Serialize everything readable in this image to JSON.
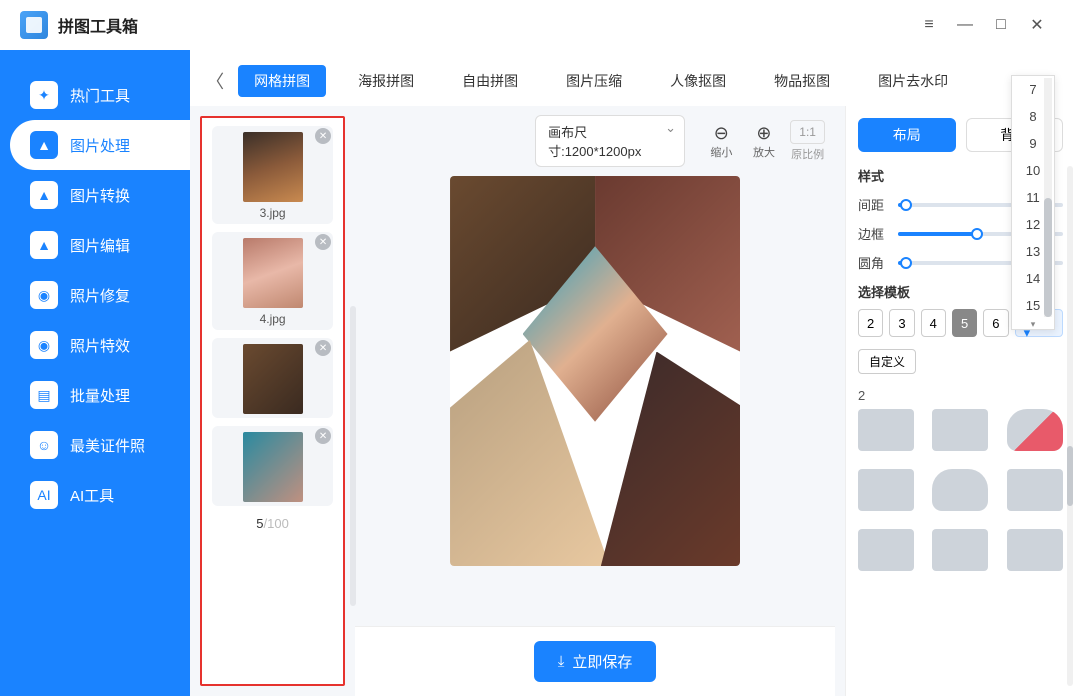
{
  "app": {
    "title": "拼图工具箱"
  },
  "window": {
    "menu": "≡",
    "minimize": "—",
    "maximize": "□",
    "close": "✕"
  },
  "sidebar": {
    "items": [
      {
        "label": "热门工具",
        "icon": "✦"
      },
      {
        "label": "图片处理",
        "icon": "▲"
      },
      {
        "label": "图片转换",
        "icon": "▲"
      },
      {
        "label": "图片编辑",
        "icon": "▲"
      },
      {
        "label": "照片修复",
        "icon": "◉"
      },
      {
        "label": "照片特效",
        "icon": "◉"
      },
      {
        "label": "批量处理",
        "icon": "▤"
      },
      {
        "label": "最美证件照",
        "icon": "☺"
      },
      {
        "label": "AI工具",
        "icon": "AI"
      }
    ],
    "active_index": 1
  },
  "tabs": {
    "back": "〈",
    "items": [
      "网格拼图",
      "海报拼图",
      "自由拼图",
      "图片压缩",
      "人像抠图",
      "物品抠图",
      "图片去水印"
    ],
    "active_index": 0
  },
  "canvas": {
    "size_label": "画布尺寸:1200*1200px",
    "zoom_out": "缩小",
    "zoom_in": "放大",
    "ratio": "1:1",
    "ratio_label": "原比例"
  },
  "thumbnails": {
    "items": [
      {
        "name": "3.jpg"
      },
      {
        "name": "4.jpg"
      },
      {
        "name": ""
      },
      {
        "name": ""
      }
    ],
    "count": "5",
    "max": "/100"
  },
  "save_button": "立即保存",
  "right_panel": {
    "tabs": [
      "布局",
      "背景"
    ],
    "active_tab": 0,
    "style_title": "样式",
    "sliders": [
      {
        "label": "间距",
        "percent": 5
      },
      {
        "label": "边框",
        "percent": 48
      },
      {
        "label": "圆角",
        "percent": 5
      }
    ],
    "template_title": "选择模板",
    "count_buttons": [
      "2",
      "3",
      "4",
      "5",
      "6"
    ],
    "count_active_index": 3,
    "more_label": "更... ▾",
    "custom_label": "自定义",
    "template_group_label": "2"
  },
  "dropdown": {
    "items": [
      "7",
      "8",
      "9",
      "10",
      "11",
      "12",
      "13",
      "14",
      "15"
    ]
  }
}
